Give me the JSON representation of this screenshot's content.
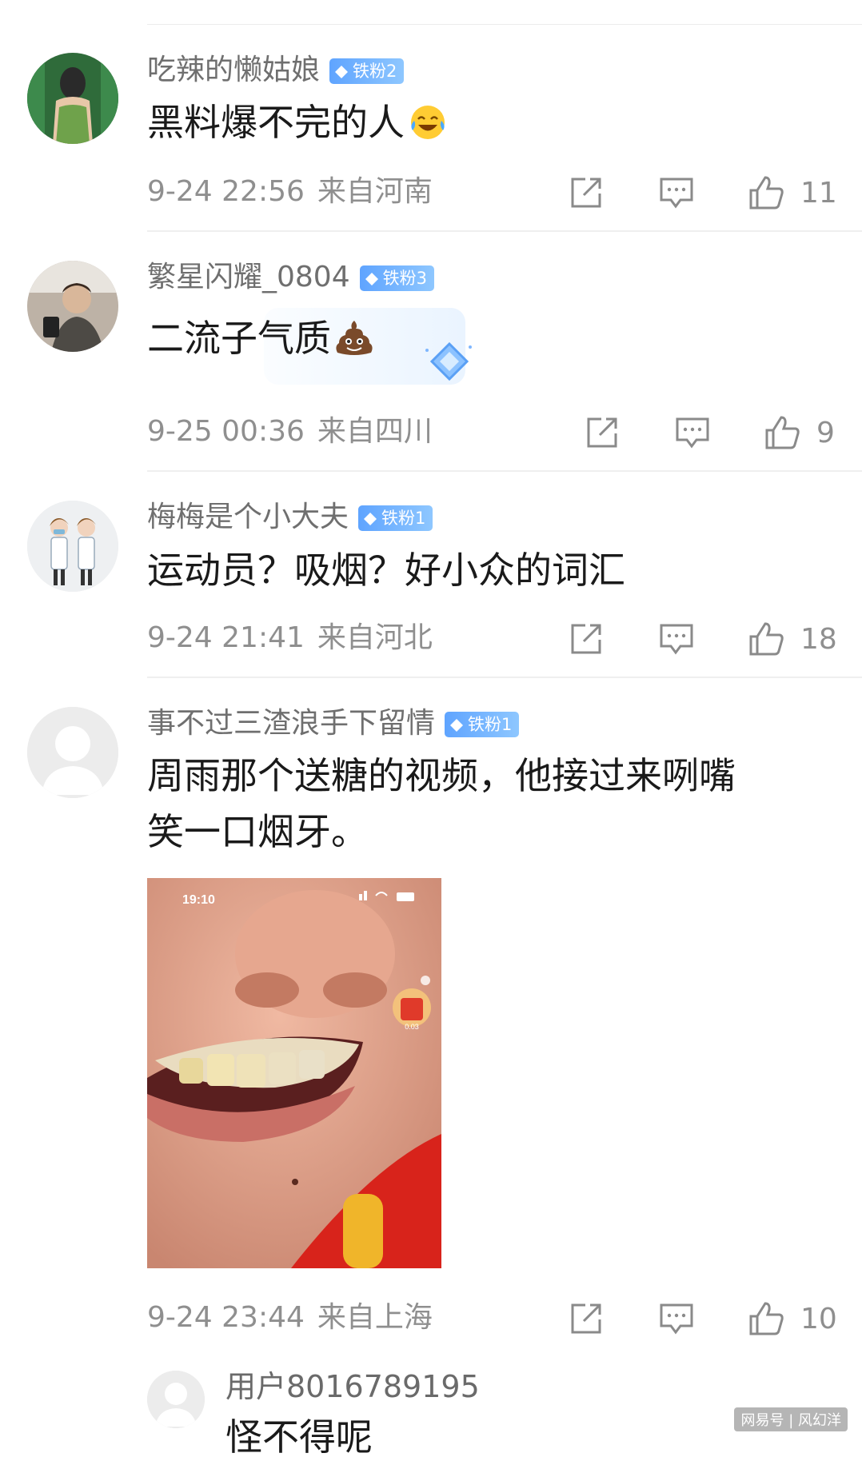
{
  "comments": [
    {
      "username": "吃辣的懒姑娘",
      "badge": "铁粉2",
      "text": "黑料爆不完的人",
      "emoji": "laughing-tears-emoji",
      "time": "9-24 22:56",
      "location": "来自河南",
      "likes": "11"
    },
    {
      "username": "繁星闪耀_0804",
      "badge": "铁粉3",
      "text": "二流子气质",
      "emoji": "poop-emoji",
      "time": "9-25 00:36",
      "location": "来自四川",
      "likes": "9"
    },
    {
      "username": "梅梅是个小大夫",
      "badge": "铁粉1",
      "text": "运动员？吸烟？好小众的词汇",
      "time": "9-24 21:41",
      "location": "来自河北",
      "likes": "18"
    },
    {
      "username": "事不过三渣浪手下留情",
      "badge": "铁粉1",
      "text_line1": "周雨那个送糖的视频，他接过来咧嘴",
      "text_line2": "笑一口烟牙。",
      "image": {
        "status_time": "19:10",
        "reward_amount": "0.03"
      },
      "time": "9-24 23:44",
      "location": "来自上海",
      "likes": "10"
    },
    {
      "username": "用户8016789195",
      "text": "怪不得呢"
    }
  ],
  "watermark": "网易号 | 风幻洋",
  "colors": {
    "badge_start": "#5fa4ff",
    "badge_end": "#8ec7ff",
    "meta_gray": "#8f8f8f",
    "name_gray": "#6f6f6f"
  }
}
